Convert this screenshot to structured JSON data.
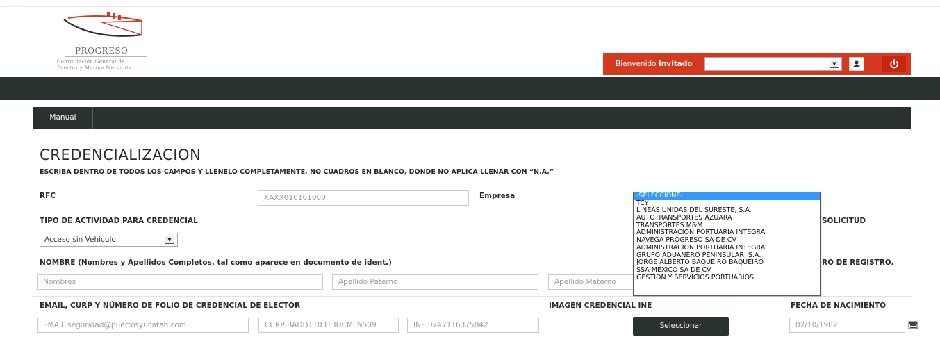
{
  "logo": {
    "name": "PROGRESO",
    "subtitle_line1": "Coordinación General de",
    "subtitle_line2": "Puertos y Marina Mercante"
  },
  "header": {
    "welcome_prefix": "Bienvenido",
    "welcome_user": "Invitado",
    "user_select_value": ""
  },
  "nav": {
    "items": [
      {
        "label": "Manual"
      }
    ]
  },
  "page": {
    "title": "CREDENCIALIZACION",
    "instructions": "ESCRIBA DENTRO DE TODOS LOS CAMPOS Y LLENELO COMPLETAMENTE, NO CUADROS EN BLANCO, DONDE NO APLICA LLENAR CON “N.A.”"
  },
  "form": {
    "rfc": {
      "label": "RFC",
      "placeholder": "XAXX010101000"
    },
    "empresa": {
      "label": "Empresa",
      "options": [
        "-SELECCIONE-",
        "TCY",
        "LINEAS UNIDAS DEL SURESTE, S.A.",
        "AUTOTRANSPORTES AZUARA",
        "TRANSPORTES M&M.",
        "ADMINISTRACION PORTUARIA INTEGRA",
        "NAVEGA PROGRESO SA DE CV",
        "ADMINISTRACION PORTUARIA INTEGRA",
        "GRUPO ADUANERO PENINSULAR, S.A.",
        "JORGE ALBERTO BAQUEIRO BAQUEIRO",
        "SSA MEXICO SA DE CV",
        "GESTION Y SERVICIOS PORTUARIOS"
      ],
      "selected": "-SELECCIONE-"
    },
    "tipo_actividad": {
      "label": "TIPO DE ACTIVIDAD PARA CREDENCIAL",
      "value": "Acceso sin Vehiculo"
    },
    "solicitud_label_partial": "SOLICITUD",
    "nombre": {
      "label": "NOMBRE (Nombres y Apellidos Completos, tal como aparece en documento de ident.)",
      "nombres_placeholder": "Nombres",
      "paterno_placeholder": "Apellido Paterno",
      "materno_placeholder": "Apellido Materno"
    },
    "registro_label_partial": "RO DE REGISTRO.",
    "email_group": {
      "label": "EMAIL, CURP Y NÚMERO DE FOLIO DE CREDENCIAL DE ELECTOR",
      "email_placeholder": "EMAIL seguridad@puertosyucatan.com",
      "curp_placeholder": "CURP BADD110313HCMLNS09",
      "ine_placeholder": "INE 0747116375842"
    },
    "imagen_ine": {
      "label": "IMAGEN CREDENCIAL INE",
      "button": "Seleccionar"
    },
    "fecha_nacimiento": {
      "label": "FECHA DE NACIMIENTO",
      "placeholder": "02/10/1982"
    }
  },
  "colors": {
    "header_red": "#d33a1f",
    "power_red": "#c6260d",
    "dark_bar": "#2a3231",
    "selected_option": "#3399ff"
  },
  "icons": [
    "ship-logo-icon",
    "user-icon",
    "power-icon",
    "dropdown-arrow-icon",
    "calendar-icon"
  ]
}
